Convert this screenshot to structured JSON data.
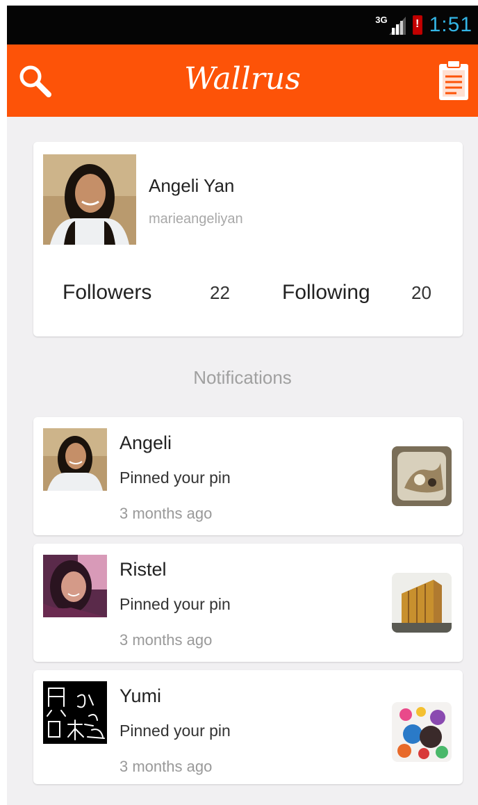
{
  "status_bar": {
    "network": "3G",
    "time": "1:51"
  },
  "app_bar": {
    "title": "Wallrus",
    "left_icon": "search-icon",
    "right_icon": "clipboard-icon",
    "color": "#fd5308"
  },
  "profile": {
    "name": "Angeli Yan",
    "username": "marieangeliyan",
    "followers_label": "Followers",
    "followers_count": "22",
    "following_label": "Following",
    "following_count": "20"
  },
  "notifications_title": "Notifications",
  "notifications": [
    {
      "name": "Angeli",
      "action": "Pinned your pin",
      "time": "3 months ago"
    },
    {
      "name": "Ristel",
      "action": "Pinned your pin",
      "time": "3 months ago"
    },
    {
      "name": "Yumi",
      "action": "Pinned your pin",
      "time": "3 months ago"
    }
  ]
}
